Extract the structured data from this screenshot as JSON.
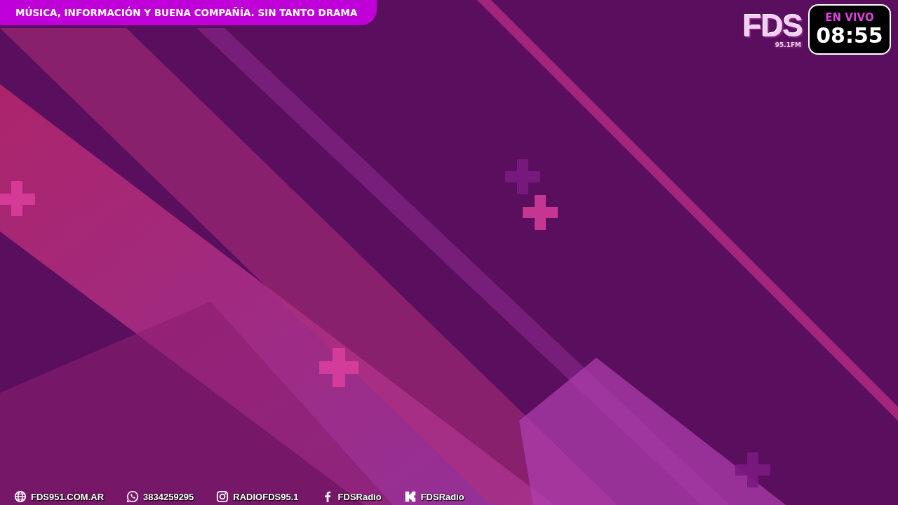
{
  "top_banner": {
    "text": "MÚSICA, INFORMACIÓN Y BUENA COMPAÑÍA. SIN TANTO DRAMA"
  },
  "logo": {
    "name": "FDS",
    "frequency": "95.1FM"
  },
  "live_badge": {
    "label": "EN VIVO",
    "time": "08:55"
  },
  "ticker": [
    {
      "kind": "web",
      "text": "FDS951.COM.AR"
    },
    {
      "kind": "whatsapp",
      "text": "3834259295"
    },
    {
      "kind": "instagram",
      "text": "RADIOFDS95.1"
    },
    {
      "kind": "facebook",
      "text": "FDSRadio"
    },
    {
      "kind": "kick",
      "text": "FDSRadio"
    }
  ]
}
